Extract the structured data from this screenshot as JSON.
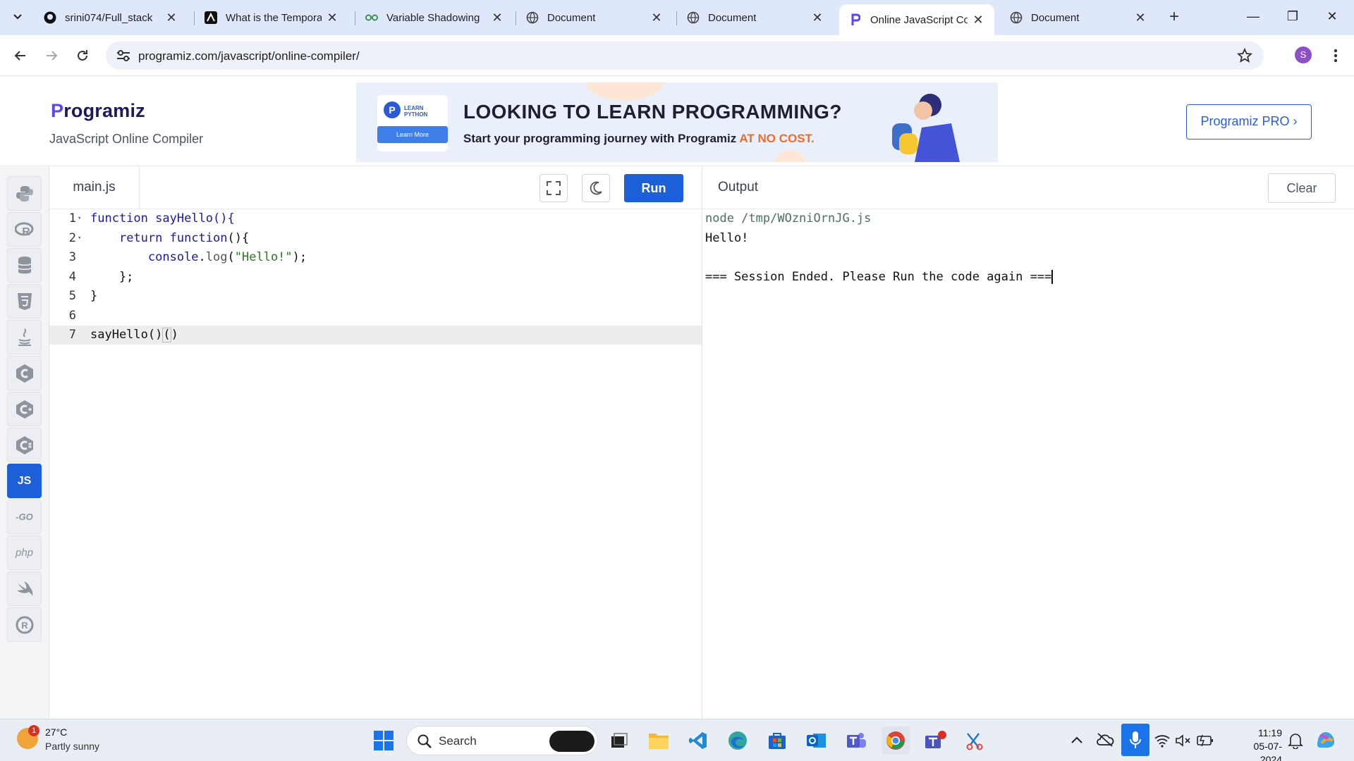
{
  "browser": {
    "tabs": [
      {
        "title": "srini074/Full_stack",
        "icon": "github-icon"
      },
      {
        "title": "What is the Temporal",
        "icon": "next-icon"
      },
      {
        "title": "Variable Shadowing",
        "icon": "gfg-icon"
      },
      {
        "title": "Document",
        "icon": "globe-icon"
      },
      {
        "title": "Document",
        "icon": "globe-icon"
      },
      {
        "title": "Online JavaScript Co",
        "icon": "programiz-icon",
        "active": true
      },
      {
        "title": "Document",
        "icon": "globe-icon"
      }
    ],
    "url": "programiz.com/javascript/online-compiler/",
    "profile_initial": "S"
  },
  "site": {
    "logo": "rogramiz",
    "logo_p": "P",
    "subtitle": "JavaScript Online Compiler",
    "banner": {
      "card_label": "LEARN PYTHON",
      "card_button": "Learn More",
      "headline": "LOOKING TO LEARN PROGRAMMING?",
      "tagline": "Start your programming journey with Programiz",
      "tagline_highlight": "AT NO COST."
    },
    "pro_button": "Programiz PRO ›"
  },
  "sidebar": {
    "languages": [
      {
        "name": "python-icon",
        "glyph": "🐍"
      },
      {
        "name": "r-icon",
        "glyph": "R"
      },
      {
        "name": "sql-icon",
        "glyph": "≡"
      },
      {
        "name": "html-icon",
        "glyph": "5"
      },
      {
        "name": "java-icon",
        "glyph": "☕"
      },
      {
        "name": "c-icon",
        "glyph": "C"
      },
      {
        "name": "cpp-icon",
        "glyph": "C"
      },
      {
        "name": "csharp-icon",
        "glyph": "C"
      },
      {
        "name": "javascript-icon",
        "glyph": "JS",
        "active": true
      },
      {
        "name": "go-icon",
        "glyph": "GO"
      },
      {
        "name": "php-icon",
        "glyph": "php"
      },
      {
        "name": "swift-icon",
        "glyph": "➶"
      },
      {
        "name": "rust-icon",
        "glyph": "R"
      }
    ]
  },
  "editor": {
    "file_name": "main.js",
    "run_label": "Run",
    "lines": [
      {
        "num": "1",
        "fold": true
      },
      {
        "num": "2",
        "fold": true
      },
      {
        "num": "3"
      },
      {
        "num": "4"
      },
      {
        "num": "5"
      },
      {
        "num": "6"
      },
      {
        "num": "7",
        "current": true
      }
    ],
    "code": {
      "l1_kw": "function",
      "l1_rest": " sayHello(){",
      "l2_indent": "    ",
      "l2_kw": "return",
      "l2_kw2": " function",
      "l2_rest": "(){",
      "l3_indent": "        ",
      "l3_obj": "console",
      "l3_dot": ".",
      "l3_fn": "log",
      "l3_open": "(",
      "l3_str": "\"Hello!\"",
      "l3_close": ");",
      "l4": "    };",
      "l5": "}",
      "l6": "",
      "l7_a": "sayHello()",
      "l7_b": "(",
      "l7_c": ")"
    }
  },
  "output": {
    "title": "Output",
    "clear_label": "Clear",
    "lines": [
      "node /tmp/WOzniOrnJG.js",
      "Hello!",
      "",
      "=== Session Ended. Please Run the code again ==="
    ]
  },
  "taskbar": {
    "weather_temp": "27°C",
    "weather_desc": "Partly sunny",
    "weather_badge": "1",
    "search_label": "Search",
    "time": "11:19",
    "date": "05-07-2024"
  }
}
